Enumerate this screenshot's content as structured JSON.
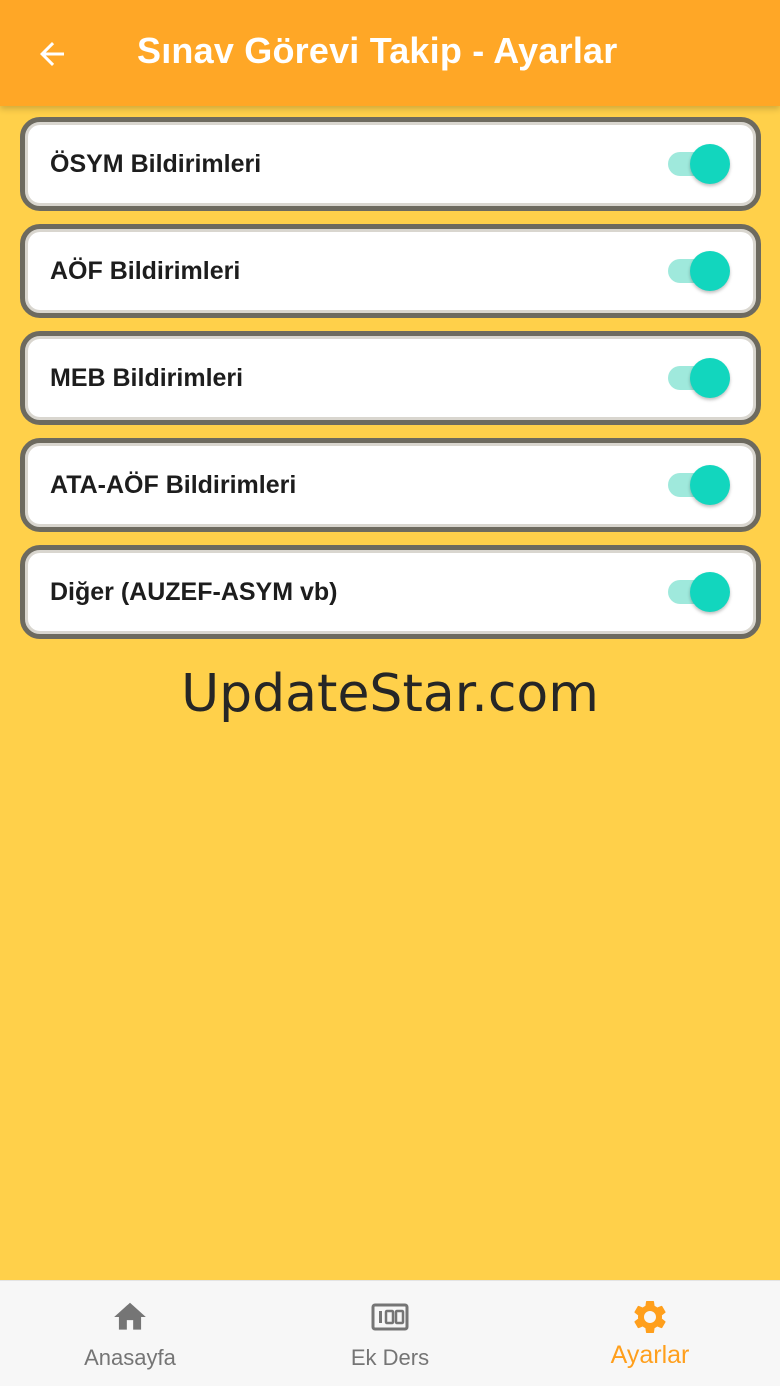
{
  "app_bar": {
    "title": "Sınav Görevi Takip - Ayarlar",
    "back_icon": "arrow-left-icon"
  },
  "settings": [
    {
      "label": "ÖSYM Bildirimleri",
      "enabled": true
    },
    {
      "label": "AÖF Bildirimleri",
      "enabled": true
    },
    {
      "label": "MEB Bildirimleri",
      "enabled": true
    },
    {
      "label": "ATA-AÖF Bildirimleri",
      "enabled": true
    },
    {
      "label": "Diğer (AUZEF-ASYM vb)",
      "enabled": true
    }
  ],
  "watermark": "UpdateStar.com",
  "bottom_nav": {
    "items": [
      {
        "label": "Anasayfa",
        "icon": "home-icon",
        "active": false
      },
      {
        "label": "Ek Ders",
        "icon": "counter-100-icon",
        "active": false
      },
      {
        "label": "Ayarlar",
        "icon": "gear-icon",
        "active": true
      }
    ]
  },
  "colors": {
    "app_bar": "#FFA726",
    "background": "#FFD04A",
    "switch_on": "#12D6BE",
    "nav_active": "#FF9F1C"
  }
}
